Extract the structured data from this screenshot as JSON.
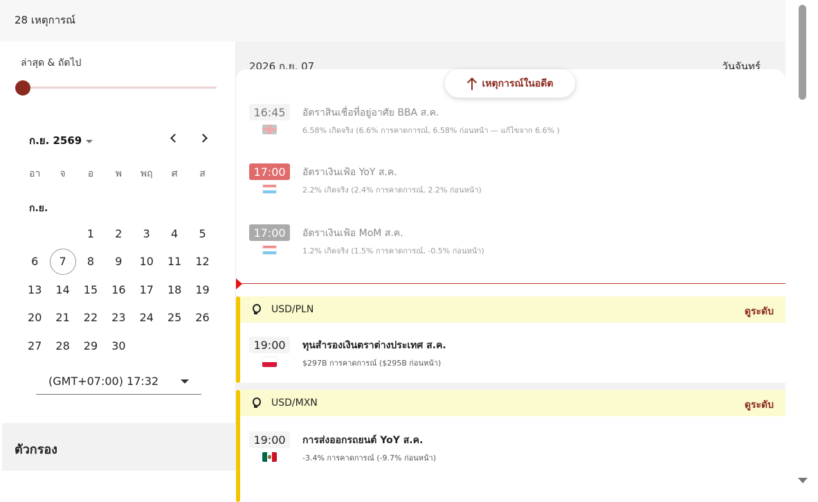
{
  "header": {
    "event_count": "28 เหตุการณ์"
  },
  "sidebar": {
    "slider_label": "ล่าสุด & ถัดไป",
    "calendar": {
      "month_title": "ก.ย. 2569",
      "weekdays": [
        "อา",
        "จ",
        "อ",
        "พ",
        "พฤ",
        "ศ",
        "ส"
      ],
      "month_abbr": "ก.ย.",
      "days": [
        "",
        "",
        "1",
        "2",
        "3",
        "4",
        "5",
        "6",
        "7",
        "8",
        "9",
        "10",
        "11",
        "12",
        "13",
        "14",
        "15",
        "16",
        "17",
        "18",
        "19",
        "20",
        "21",
        "22",
        "23",
        "24",
        "25",
        "26",
        "27",
        "28",
        "29",
        "30"
      ],
      "selected_day": "7"
    },
    "timezone": "(GMT+07:00) 17:32",
    "filters_title": "ตัวกรอง"
  },
  "main": {
    "date": "2026 ก.ย. 07",
    "weekday": "วันจันทร์",
    "past_button": "เหตุการณ์ในอดีต",
    "past_events": [
      {
        "time": "16:45",
        "flag": "uk-flag-icon",
        "name": "อัตราสินเชื่อที่อยู่อาศัย BBA ส.ค.",
        "detail": "6.58% เกิดจริง (6.6% การคาดการณ์, 6.58% ก่อนหน้า — แก้ไขจาก 6.6% )"
      },
      {
        "time": "17:00",
        "flag": "luxembourg-flag-icon",
        "name": "อัตราเงินเฟ้อ YoY ส.ค.",
        "detail": "2.2% เกิดจริง (2.4% การคาดการณ์, 2.2% ก่อนหน้า)"
      },
      {
        "time": "17:00",
        "flag": "luxembourg-flag-icon",
        "name": "อัตราเงินเฟ้อ MoM ส.ค.",
        "detail": "1.2% เกิดจริง (1.5% การคาดการณ์, -0.5% ก่อนหน้า)"
      }
    ],
    "groups": [
      {
        "pair": "USD/PLN",
        "view": "ดูระดับ",
        "event": {
          "time": "19:00",
          "flag": "poland-flag-icon",
          "name": "ทุนสำรองเงินตราต่างประเทศ ส.ค.",
          "detail": "$297B การคาดการณ์ ($295B ก่อนหน้า)"
        }
      },
      {
        "pair": "USD/MXN",
        "view": "ดูระดับ",
        "event": {
          "time": "19:00",
          "flag": "mexico-flag-icon",
          "name": "การส่งออกรถยนต์ YoY ส.ค.",
          "detail": "-3.4% การคาดการณ์ (-9.7% ก่อนหน้า)"
        }
      }
    ]
  },
  "colors": {
    "accent": "#8b2a1f",
    "now_line": "#c0392b",
    "highlight_time": "#e06b6b",
    "group_bar": "#f5c400",
    "group_header": "#fbfbcf"
  }
}
